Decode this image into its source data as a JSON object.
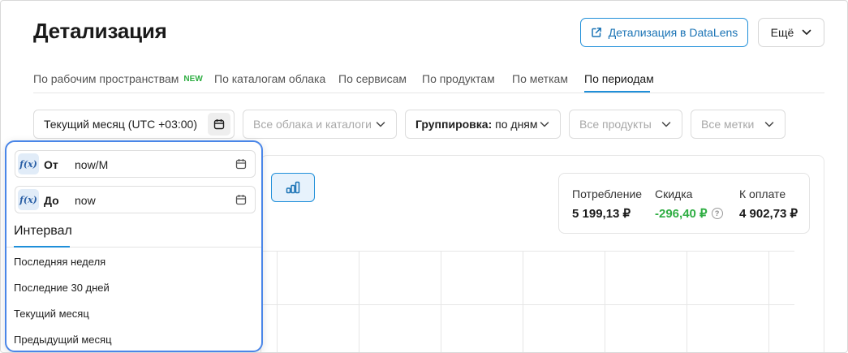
{
  "header": {
    "title": "Детализация",
    "datalens_button": "Детализация в DataLens",
    "more_button": "Ещё"
  },
  "tabs": [
    {
      "label": "По рабочим пространствам",
      "badge": "NEW"
    },
    {
      "label": "По каталогам облака"
    },
    {
      "label": "По сервисам"
    },
    {
      "label": "По продуктам"
    },
    {
      "label": "По меткам"
    },
    {
      "label": "По периодам",
      "active": true
    }
  ],
  "filters": {
    "date_range": "Текущий месяц (UTC +03:00)",
    "clouds": "Все облака и каталоги",
    "grouping_label": "Группировка:",
    "grouping_value": "по дням",
    "products": "Все продукты",
    "labels": "Все метки"
  },
  "summary": {
    "consumption_label": "Потребление",
    "consumption_value": "5 199,13 ₽",
    "discount_label": "Скидка",
    "discount_value": "-296,40 ₽",
    "payment_label": "К оплате",
    "payment_value": "4 902,73 ₽"
  },
  "date_popup": {
    "from_label": "От",
    "from_value": "now/M",
    "to_label": "До",
    "to_value": "now",
    "fx_icon": "f(x)",
    "interval_title": "Интервал",
    "presets": [
      "Последняя неделя",
      "Последние 30 дней",
      "Текущий месяц",
      "Предыдущий месяц"
    ]
  },
  "colors": {
    "accent": "#1f8fd9",
    "positive": "#2fae43",
    "popup_border": "#4a86e8"
  }
}
